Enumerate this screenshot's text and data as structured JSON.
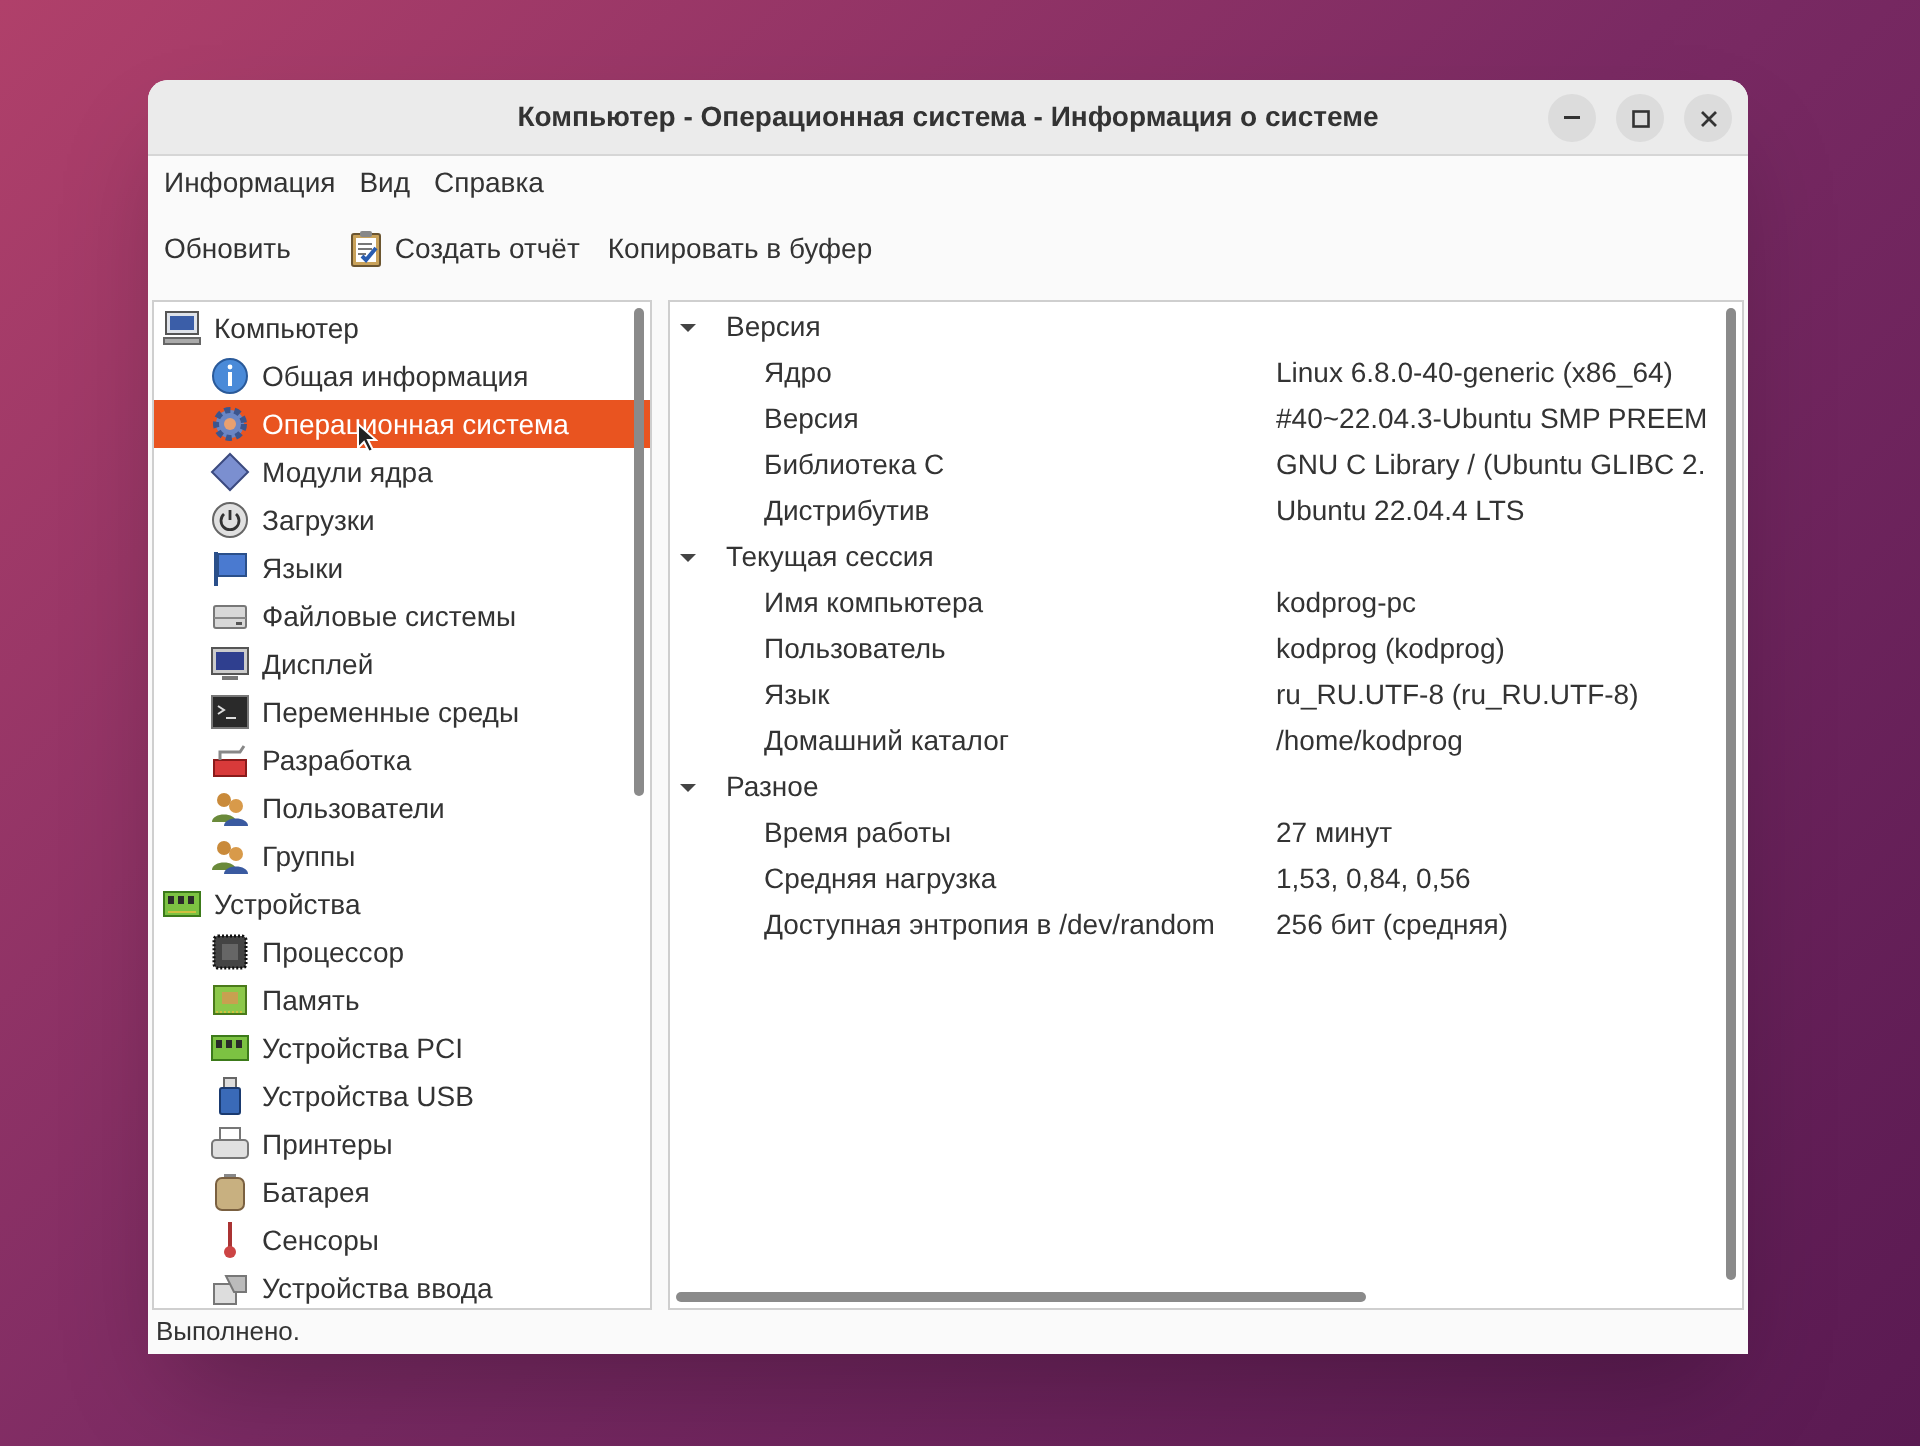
{
  "window": {
    "title": "Компьютер - Операционная система - Информация о системе"
  },
  "menu": [
    "Информация",
    "Вид",
    "Справка"
  ],
  "toolbar": [
    {
      "label": "Обновить",
      "kind": "plain"
    },
    {
      "label": "Создать отчёт",
      "kind": "icon"
    },
    {
      "label": "Копировать в буфер",
      "kind": "plain"
    }
  ],
  "sidebar": {
    "items": [
      {
        "label": "Компьютер",
        "selected": false,
        "expanded": true,
        "children": [
          {
            "label": "Общая информация",
            "selected": false
          },
          {
            "label": "Операционная система",
            "selected": true
          },
          {
            "label": "Модули ядра",
            "selected": false
          },
          {
            "label": "Загрузки",
            "selected": false
          },
          {
            "label": "Языки",
            "selected": false
          },
          {
            "label": "Файловые системы",
            "selected": false
          },
          {
            "label": "Дисплей",
            "selected": false
          },
          {
            "label": "Переменные среды",
            "selected": false
          },
          {
            "label": "Разработка",
            "selected": false
          },
          {
            "label": "Пользователи",
            "selected": false
          },
          {
            "label": "Группы",
            "selected": false
          }
        ]
      },
      {
        "label": "Устройства",
        "selected": false,
        "expanded": true,
        "children": [
          {
            "label": "Процессор",
            "selected": false
          },
          {
            "label": "Память",
            "selected": false
          },
          {
            "label": "Устройства PCI",
            "selected": false
          },
          {
            "label": "Устройства USB",
            "selected": false
          },
          {
            "label": "Принтеры",
            "selected": false
          },
          {
            "label": "Батарея",
            "selected": false
          },
          {
            "label": "Сенсоры",
            "selected": false
          },
          {
            "label": "Устройства ввода",
            "selected": false
          }
        ]
      }
    ]
  },
  "details": [
    {
      "title": "Версия",
      "expanded": true,
      "rows": [
        {
          "label": "Ядро",
          "value": "Linux 6.8.0-40-generic (x86_64)"
        },
        {
          "label": "Версия",
          "value": "#40~22.04.3-Ubuntu SMP PREEM"
        },
        {
          "label": "Библиотека C",
          "value": "GNU C Library / (Ubuntu GLIBC 2."
        },
        {
          "label": "Дистрибутив",
          "value": "Ubuntu 22.04.4 LTS"
        }
      ]
    },
    {
      "title": "Текущая сессия",
      "expanded": true,
      "rows": [
        {
          "label": "Имя компьютера",
          "value": "kodprog-pc"
        },
        {
          "label": "Пользователь",
          "value": "kodprog (kodprog)"
        },
        {
          "label": "Язык",
          "value": "ru_RU.UTF-8 (ru_RU.UTF-8)"
        },
        {
          "label": "Домашний каталог",
          "value": "/home/kodprog"
        }
      ]
    },
    {
      "title": "Разное",
      "expanded": true,
      "rows": [
        {
          "label": "Время работы",
          "value": "27 минут"
        },
        {
          "label": "Средняя нагрузка",
          "value": "1,53, 0,84, 0,56"
        },
        {
          "label": "Доступная энтропия в /dev/random",
          "value": "256 бит (средняя)"
        }
      ]
    }
  ],
  "status_bar": "Выполнено."
}
